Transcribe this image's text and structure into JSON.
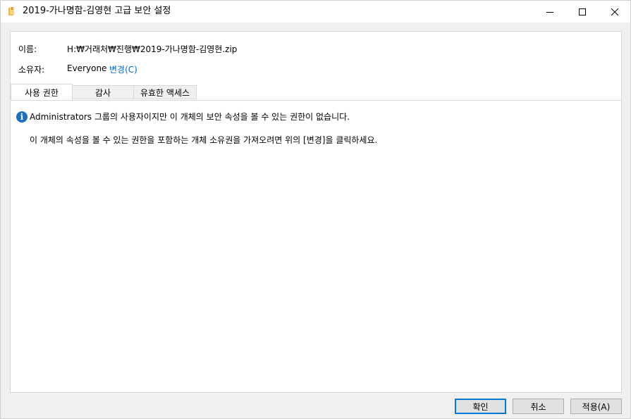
{
  "window": {
    "title": "2019-가나명함-김영현 고급 보안 설정",
    "icon": "folder-icon"
  },
  "fields": {
    "name_label": "이름:",
    "name_value": "H:₩거래처₩진행₩2019-가나명함-김영현.zip",
    "owner_label": "소유자:",
    "owner_value": "Everyone",
    "change_link": "변경(C)"
  },
  "tabs": [
    {
      "label": "사용 권한",
      "active": true
    },
    {
      "label": "감사",
      "active": false
    },
    {
      "label": "유효한 액세스",
      "active": false
    }
  ],
  "message": {
    "info_icon": "info-icon",
    "line1": "Administrators 그룹의 사용자이지만 이 개체의 보안 속성을 볼 수 있는 권한이 없습니다.",
    "line2": "이 개체의 속성을 볼 수 있는 권한을 포함하는 개체 소유권을 가져오려면 위의 [변경]을 클릭하세요."
  },
  "buttons": {
    "ok": "확인",
    "cancel": "취소",
    "apply": "적용(A)"
  },
  "colors": {
    "link": "#0066cc",
    "accent": "#0078d7",
    "info": "#1e6fc2"
  }
}
